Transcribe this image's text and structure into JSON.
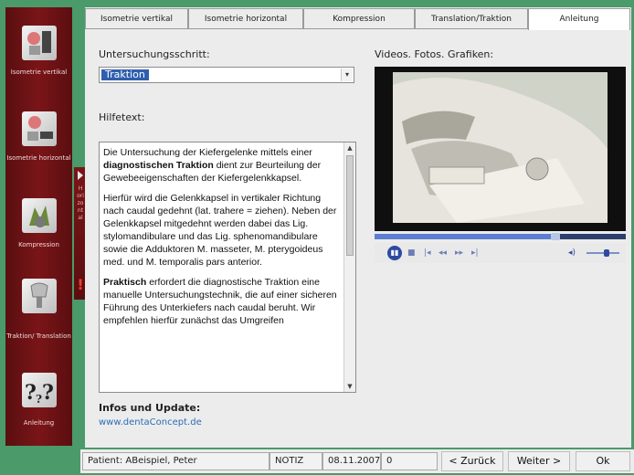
{
  "sidebar": {
    "items": [
      {
        "label": "Isometrie vertikal",
        "icon": "isometric-vertical-icon"
      },
      {
        "label": "Isometrie horizontal",
        "icon": "isometric-horizontal-icon"
      },
      {
        "label": "Kompression",
        "icon": "compression-icon"
      },
      {
        "label": "Traktion/ Translation",
        "icon": "traction-icon"
      },
      {
        "label": "Anleitung",
        "icon": "help-icon"
      }
    ],
    "collapse_label": "Horizontal",
    "collapse_warning": "!"
  },
  "tabs": [
    {
      "label": "Isometrie vertikal"
    },
    {
      "label": "Isometrie horizontal"
    },
    {
      "label": "Kompression"
    },
    {
      "label": "Translation/Traktion"
    },
    {
      "label": "Anleitung"
    }
  ],
  "main": {
    "step_label": "Untersuchungsschritt:",
    "step_value": "Traktion",
    "help_label": "Hilfetext:",
    "help_paragraphs": [
      "Die Untersuchung der Kiefergelenke mittels einer diagnostischen Traktion dient zur Beurteilung der Gewebeeigenschaften der Kiefergelenkkapsel.",
      "Hierfür wird die Gelenkkapsel in vertikaler Richtung nach caudal gedehnt (lat. trahere = ziehen). Neben der Gelenkkapsel mitgedehnt werden dabei das Lig. stylomandibulare und das Lig. sphenomandibulare sowie die Adduktoren M. masseter, M. pterygoideus med. und M. temporalis pars anterior.",
      "Praktisch erfordert die diagnostische Traktion eine manuelle Untersuchungstechnik, die auf einer sicheren Führung des Unterkiefers nach caudal beruht. Wir empfehlen hierfür zunächst das Umgreifen"
    ],
    "info_label": "Infos und Update:",
    "info_link": "www.dentaConcept.de",
    "media_label": "Videos. Fotos. Grafiken:"
  },
  "player": {
    "progress": 0.72,
    "play_symbol": "▮▮",
    "controls": [
      "■",
      "|◂",
      "◂◂",
      "▸▸",
      "▸|"
    ],
    "volume_symbol": "◂)",
    "volume_level": 0.6
  },
  "status": {
    "patient": "Patient: ABeispiel, Peter",
    "notiz": "NOTIZ",
    "date": "08.11.2007",
    "count": "0",
    "back": "< Zurück",
    "next": "Weiter >",
    "ok": "Ok"
  },
  "colors": {
    "sidebar": "#6e1416",
    "frame": "#4a9a6a",
    "selection": "#2f5fae",
    "link": "#2a6db6"
  }
}
